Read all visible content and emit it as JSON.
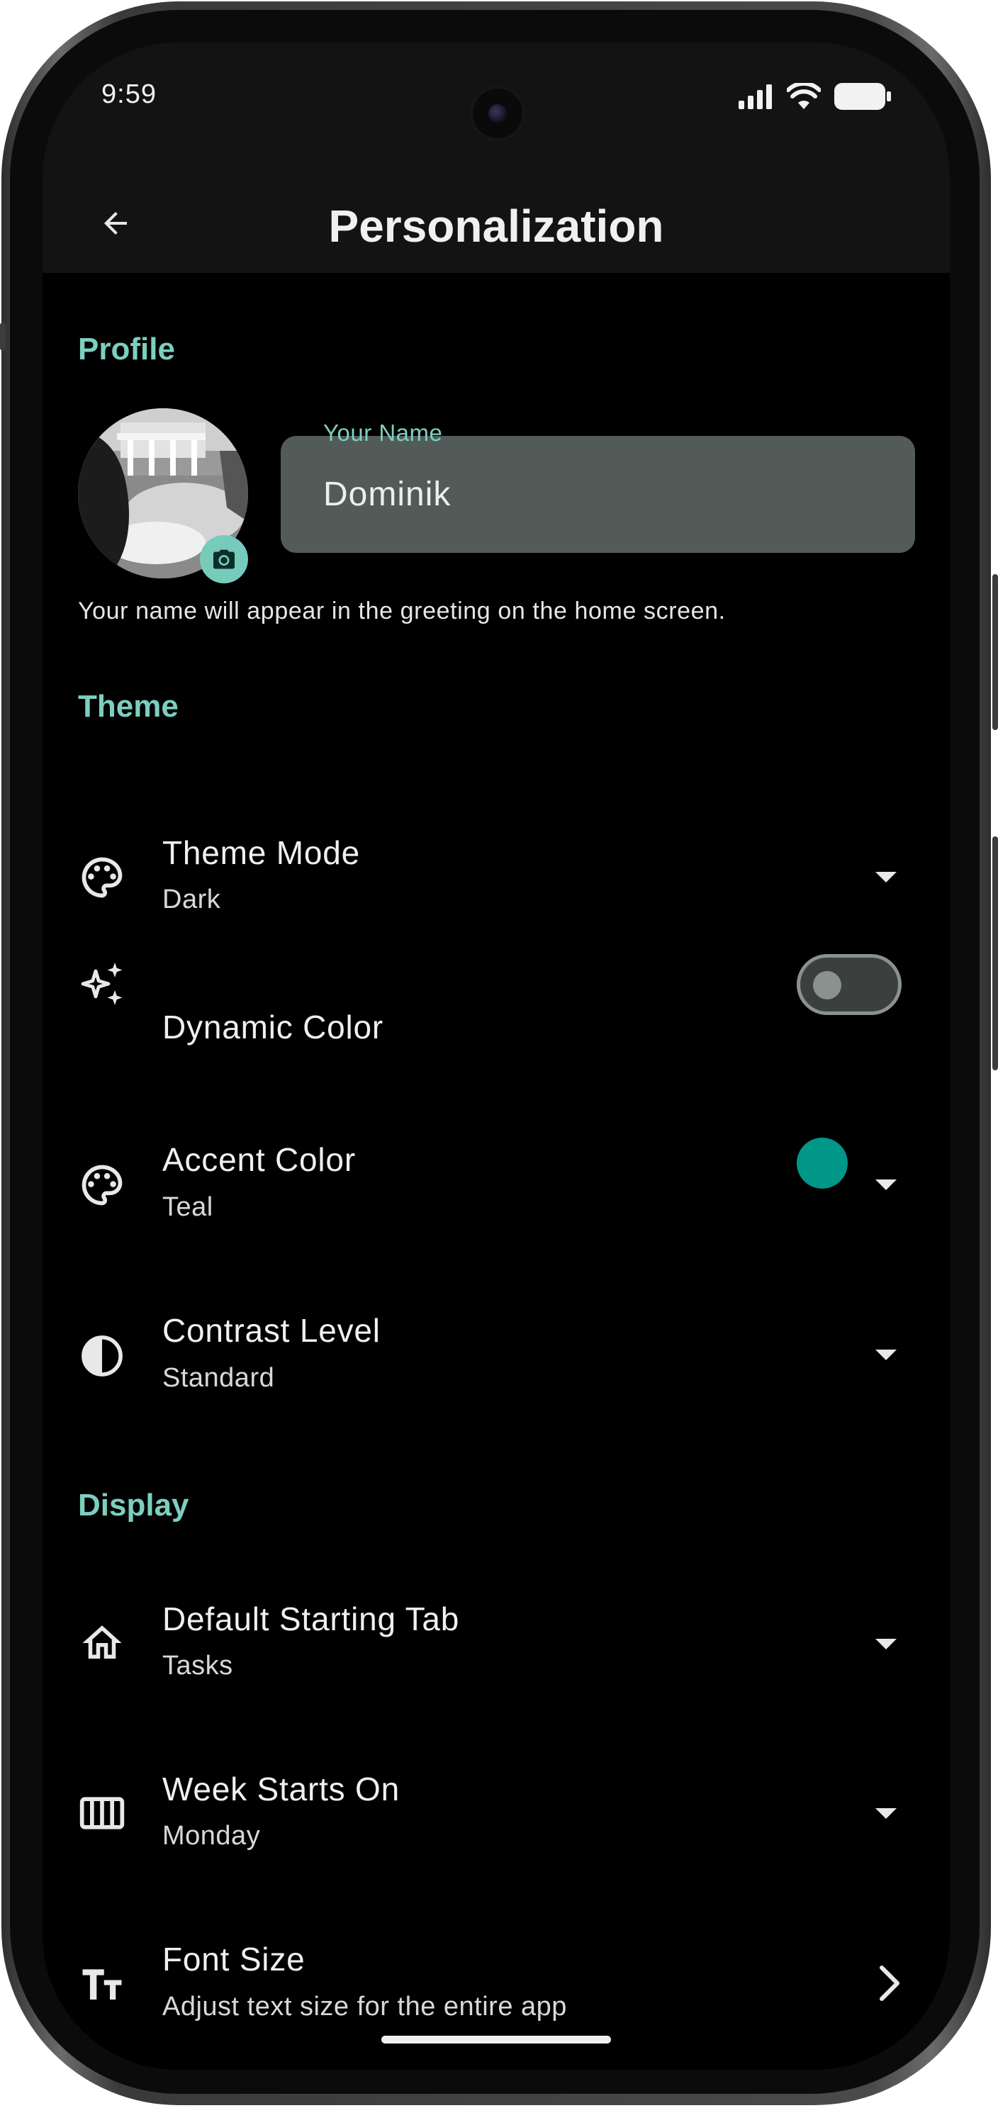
{
  "status_bar": {
    "time": "9:59"
  },
  "app_bar": {
    "title": "Personalization"
  },
  "profile": {
    "section_title": "Profile",
    "name_label": "Your Name",
    "name_value": "Dominik",
    "helper": "Your name will appear in the greeting on the home screen."
  },
  "theme": {
    "section_title": "Theme",
    "theme_mode": {
      "title": "Theme Mode",
      "value": "Dark"
    },
    "dynamic_color": {
      "title": "Dynamic Color",
      "enabled": false
    },
    "accent_color": {
      "title": "Accent Color",
      "value": "Teal",
      "swatch": "#009688"
    },
    "contrast_level": {
      "title": "Contrast Level",
      "value": "Standard"
    }
  },
  "display": {
    "section_title": "Display",
    "default_tab": {
      "title": "Default Starting Tab",
      "value": "Tasks"
    },
    "week_start": {
      "title": "Week Starts On",
      "value": "Monday"
    },
    "font_size": {
      "title": "Font Size",
      "value": "Adjust text size for the entire app"
    }
  },
  "colors": {
    "accent": "#7ccfc0",
    "background": "#000000",
    "app_bar": "#131313"
  }
}
